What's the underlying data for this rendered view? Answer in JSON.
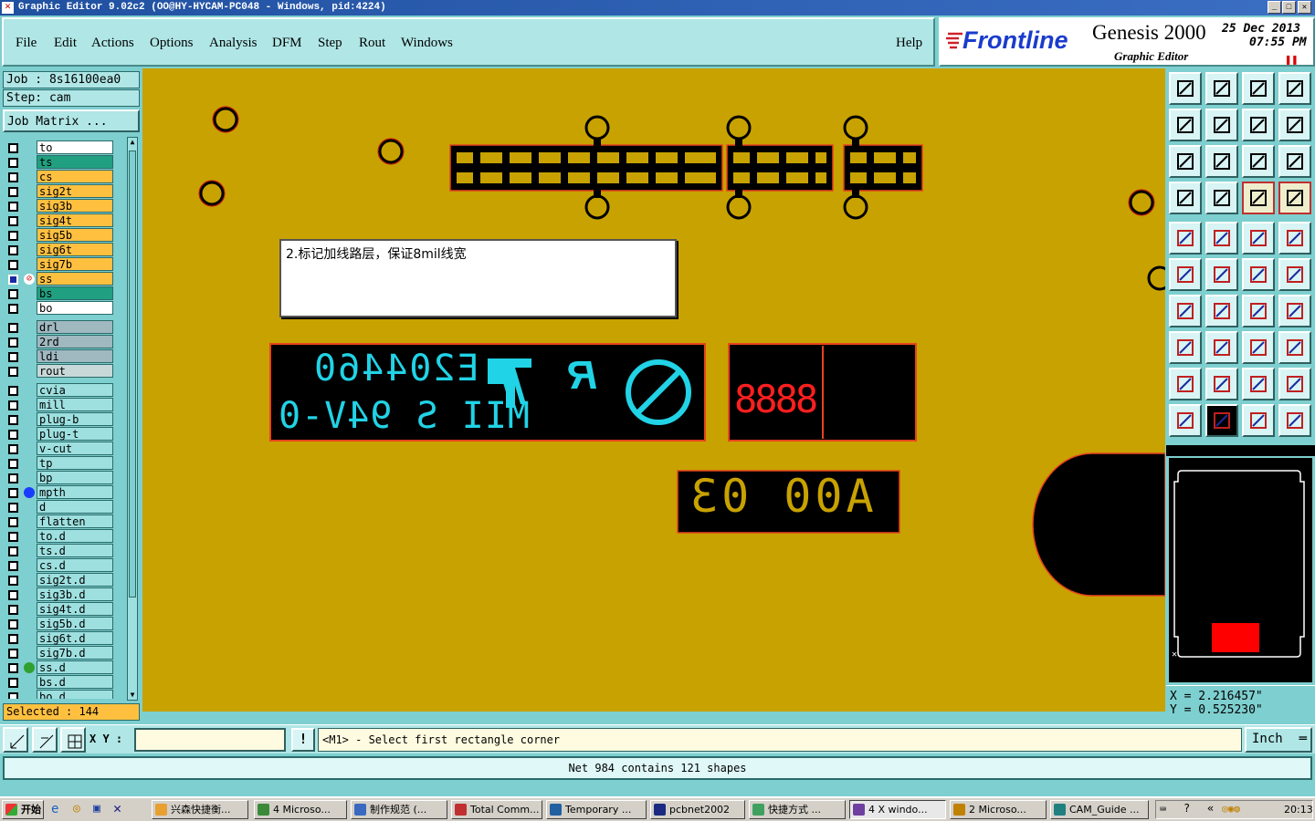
{
  "window": {
    "title": "Graphic Editor 9.02c2  (OO@HY-HYCAM-PC048 - Windows, pid:4224)"
  },
  "menu": [
    "File",
    "Edit",
    "Actions",
    "Options",
    "Analysis",
    "DFM",
    "Step",
    "Rout",
    "Windows"
  ],
  "help": "Help",
  "brand": {
    "logo": "Frontline",
    "product": "Genesis 2000",
    "subtitle": "Graphic Editor",
    "date": "25 Dec 2013",
    "time": "07:55 PM"
  },
  "job": {
    "job_label": "Job : 8s16100ea0",
    "step_label": "Step: cam",
    "matrix_button": "Job Matrix ..."
  },
  "layers": [
    {
      "name": "to",
      "color": "#ffffff"
    },
    {
      "name": "ts",
      "color": "#20a080"
    },
    {
      "name": "cs",
      "color": "#ffc040"
    },
    {
      "name": "sig2t",
      "color": "#ffc040"
    },
    {
      "name": "sig3b",
      "color": "#ffc040"
    },
    {
      "name": "sig4t",
      "color": "#ffc040"
    },
    {
      "name": "sig5b",
      "color": "#ffc040"
    },
    {
      "name": "sig6t",
      "color": "#ffc040"
    },
    {
      "name": "sig7b",
      "color": "#ffc040"
    },
    {
      "name": "ss",
      "color": "#ffc040",
      "active": true
    },
    {
      "name": "bs",
      "color": "#20a080"
    },
    {
      "name": "bo",
      "color": "#ffffff"
    },
    {
      "name": "drl",
      "color": "#a0b8c0",
      "gap": true
    },
    {
      "name": "2rd",
      "color": "#a0b8c0"
    },
    {
      "name": "ldi",
      "color": "#a0b8c0"
    },
    {
      "name": "rout",
      "color": "#c8d8d8"
    },
    {
      "name": "cvia",
      "color": "#9ee0e0",
      "gap": true
    },
    {
      "name": "mill",
      "color": "#9ee0e0"
    },
    {
      "name": "plug-b",
      "color": "#9ee0e0"
    },
    {
      "name": "plug-t",
      "color": "#9ee0e0"
    },
    {
      "name": "v-cut",
      "color": "#9ee0e0"
    },
    {
      "name": "tp",
      "color": "#9ee0e0"
    },
    {
      "name": "bp",
      "color": "#9ee0e0"
    },
    {
      "name": "mpth",
      "color": "#9ee0e0",
      "dot": "#1a3cff"
    },
    {
      "name": "d",
      "color": "#9ee0e0"
    },
    {
      "name": "flatten",
      "color": "#9ee0e0"
    },
    {
      "name": "to.d",
      "color": "#9ee0e0"
    },
    {
      "name": "ts.d",
      "color": "#9ee0e0"
    },
    {
      "name": "cs.d",
      "color": "#9ee0e0"
    },
    {
      "name": "sig2t.d",
      "color": "#9ee0e0"
    },
    {
      "name": "sig3b.d",
      "color": "#9ee0e0"
    },
    {
      "name": "sig4t.d",
      "color": "#9ee0e0"
    },
    {
      "name": "sig5b.d",
      "color": "#9ee0e0"
    },
    {
      "name": "sig6t.d",
      "color": "#9ee0e0"
    },
    {
      "name": "sig7b.d",
      "color": "#9ee0e0"
    },
    {
      "name": "ss.d",
      "color": "#9ee0e0",
      "dot": "#30a030"
    },
    {
      "name": "bs.d",
      "color": "#9ee0e0"
    },
    {
      "name": "bo.d",
      "color": "#9ee0e0"
    }
  ],
  "selected": "Selected : 144",
  "note": "2.标记加线路层，保证8mil线宽",
  "board_text": {
    "code": "E204460",
    "rating": "MII S 94V-0",
    "ul": "R",
    "digits": "8888",
    "date_code": "A00 03"
  },
  "coords": {
    "x": "X = 2.216457\"",
    "y": "Y = 0.525230\""
  },
  "command": {
    "xy_label": "X Y :",
    "input": "",
    "prompt": "<M1> - Select first rectangle corner",
    "units": "Inch"
  },
  "status": "Net 984 contains 121 shapes",
  "taskbar": {
    "start": "开始",
    "tasks": [
      "兴森快捷衡...",
      "4 Microso...",
      "制作规范 (...",
      "Total Comm...",
      "Temporary ...",
      "pcbnet2002",
      "快捷方式 ...",
      "4 X windo...",
      "2 Microso...",
      "CAM_Guide ..."
    ],
    "clock": "20:13"
  },
  "colors": {
    "board": "#c8a200",
    "outline": "#e8431c",
    "cyan_text": "#21d3e6",
    "red_digits": "#ff1f1f",
    "panel": "#7ecfcf"
  }
}
